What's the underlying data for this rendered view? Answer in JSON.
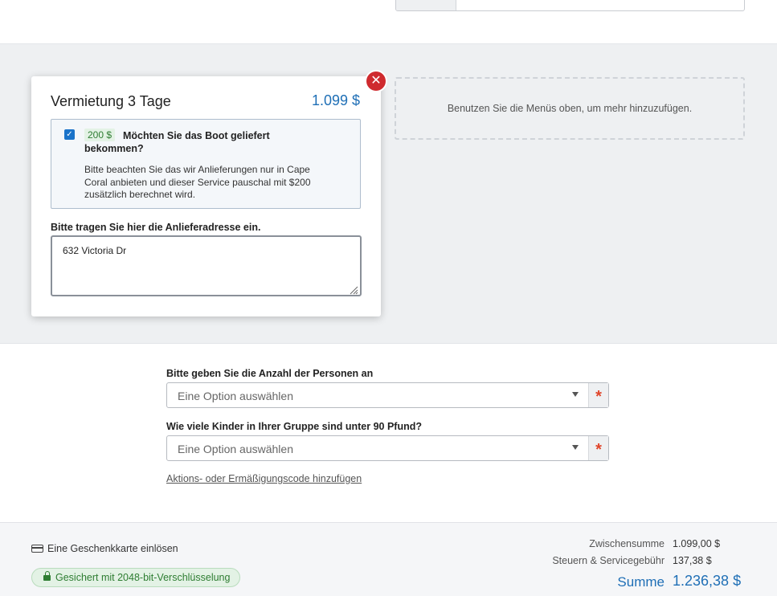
{
  "booking": {
    "title": "Vermietung 3 Tage",
    "price": "1.099 $",
    "addon": {
      "price_badge": "200 $",
      "question": "Möchten Sie das Boot geliefert bekommen?",
      "note": "Bitte beachten Sie das wir Anlieferungen nur in Cape Coral anbieten und dieser Service pauschal mit $200 zusätzlich berechnet wird.",
      "checked": true
    },
    "address_label": "Bitte tragen Sie hier die Anlieferadresse ein.",
    "address_value": "632 Victoria Dr"
  },
  "dropzone": {
    "text": "Benutzen Sie die Menüs oben, um mehr hinzuzufügen."
  },
  "form": {
    "persons_label": "Bitte geben Sie die Anzahl der Personen an",
    "persons_placeholder": "Eine Option auswählen",
    "kids_label": "Wie viele Kinder in Ihrer Gruppe sind unter 90 Pfund?",
    "kids_placeholder": "Eine Option auswählen",
    "required_mark": "*",
    "promo_link": "Aktions- oder Ermäßigungscode hinzufügen"
  },
  "footer": {
    "gift_card": "Eine Geschenkkarte einlösen",
    "secure_badge": "Gesichert mit 2048-bit-Verschlüsselung",
    "subtotal_label": "Zwischensumme",
    "subtotal_value": "1.099,00 $",
    "tax_label": "Steuern & Servicegebühr",
    "tax_value": "137,38 $",
    "total_label": "Summe",
    "total_value": "1.236,38 $"
  },
  "colors": {
    "accent": "#1f6fb6",
    "close": "#cf2a2e",
    "required": "#e0452a",
    "success": "#2e7d32"
  },
  "icons": [
    "close-icon",
    "checkbox-icon",
    "dropdown-caret-icon",
    "credit-card-icon",
    "lock-icon",
    "resize-grip-icon"
  ]
}
